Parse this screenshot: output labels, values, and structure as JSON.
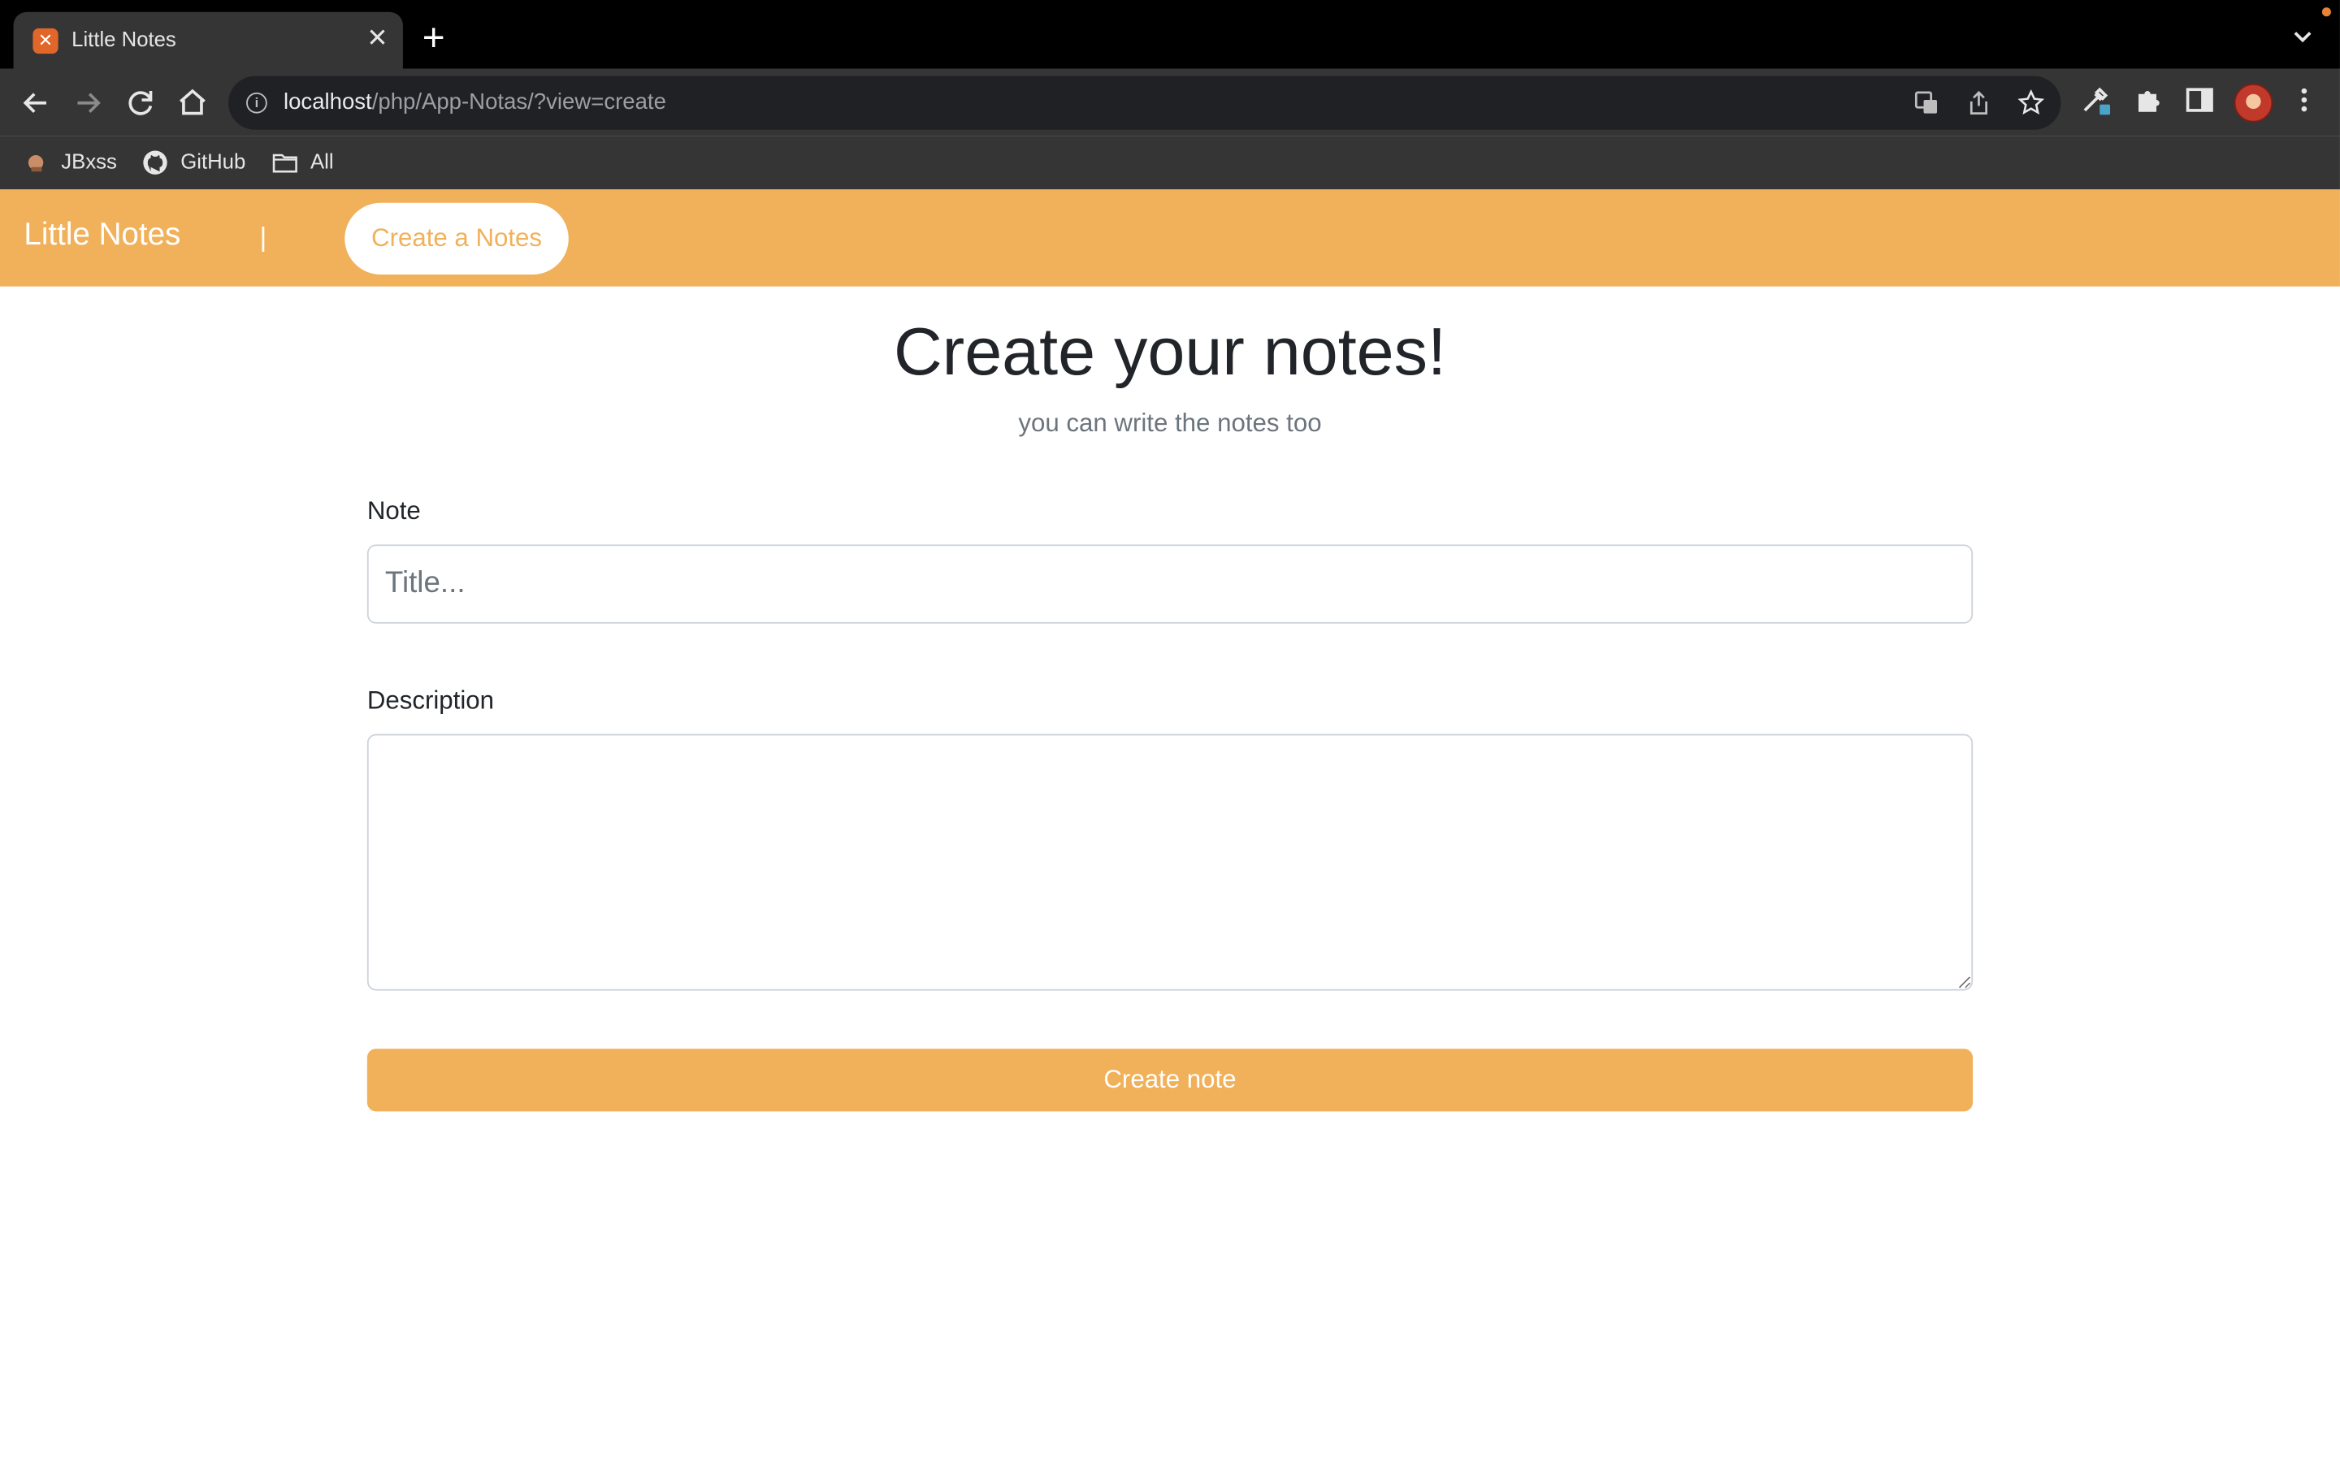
{
  "browser": {
    "tab": {
      "title": "Little Notes",
      "favicon": "xampp-icon"
    },
    "address_bar": {
      "host": "localhost",
      "path": "/php/App-Notas/?view=create"
    },
    "bookmarks": [
      {
        "label": "JBxss",
        "icon": "bookmark-favicon-icon"
      },
      {
        "label": "GitHub",
        "icon": "github-icon"
      },
      {
        "label": "All",
        "icon": "folder-icon"
      }
    ]
  },
  "navbar": {
    "brand": "Little Notes",
    "separator": "|",
    "create_link": "Create a Notes",
    "accent_color": "#f1b15b"
  },
  "page": {
    "title": "Create your notes!",
    "subtitle": "you can write the notes too"
  },
  "form": {
    "note_label": "Note",
    "title_placeholder": "Title...",
    "title_value": "",
    "description_label": "Description",
    "description_value": "",
    "submit_label": "Create note"
  }
}
